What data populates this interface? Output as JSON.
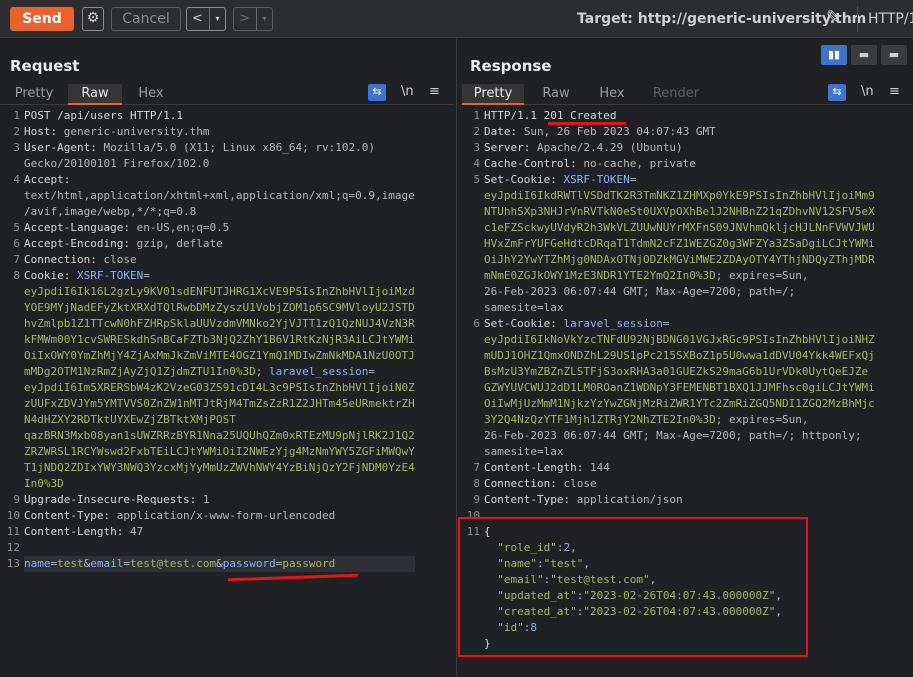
{
  "toolbar": {
    "send": "Send",
    "gear": "⚙",
    "cancel": "Cancel",
    "back": "<",
    "fwd": ">",
    "dd": "▾",
    "target": "Target: http://generic-university.thm",
    "pencil": "✎",
    "http": "HTTP/1"
  },
  "request": {
    "title": "Request",
    "tabs": [
      "Pretty",
      "Raw",
      "Hex"
    ],
    "wrap": "⇆",
    "nl": "\\n",
    "menu": "≡"
  },
  "response": {
    "title": "Response",
    "tabs": [
      "Pretty",
      "Raw",
      "Hex",
      "Render"
    ],
    "wrap": "⇆",
    "nl": "\\n",
    "menu": "≡"
  },
  "layout_buttons": [
    "▮▮",
    "▬",
    "▬"
  ],
  "request_lines": [
    {
      "n": "1",
      "segs": [
        [
          "k",
          "POST /api/users HTTP/1.1"
        ]
      ]
    },
    {
      "n": "2",
      "segs": [
        [
          "k",
          "Host: "
        ],
        [
          "v",
          "generic-university.thm"
        ]
      ]
    },
    {
      "n": "3",
      "segs": [
        [
          "k",
          "User-Agent: "
        ],
        [
          "v",
          "Mozilla/5.0 (X11; Linux x86_64; rv:102.0)"
        ]
      ]
    },
    {
      "n": "",
      "segs": [
        [
          "v",
          "Gecko/20100101 Firefox/102.0"
        ]
      ]
    },
    {
      "n": "4",
      "segs": [
        [
          "k",
          "Accept:"
        ]
      ]
    },
    {
      "n": "",
      "segs": [
        [
          "v",
          "text/html,application/xhtml+xml,application/xml;q=0.9,image"
        ]
      ]
    },
    {
      "n": "",
      "segs": [
        [
          "v",
          "/avif,image/webp,*/*;q=0.8"
        ]
      ]
    },
    {
      "n": "5",
      "segs": [
        [
          "k",
          "Accept-Language: "
        ],
        [
          "v",
          "en-US,en;q=0.5"
        ]
      ]
    },
    {
      "n": "6",
      "segs": [
        [
          "k",
          "Accept-Encoding: "
        ],
        [
          "v",
          "gzip, deflate"
        ]
      ]
    },
    {
      "n": "7",
      "segs": [
        [
          "k",
          "Connection: "
        ],
        [
          "v",
          "close"
        ]
      ]
    },
    {
      "n": "8",
      "segs": [
        [
          "k",
          "Cookie: "
        ],
        [
          "blue",
          "XSRF-TOKEN"
        ],
        [
          "v",
          "="
        ]
      ]
    },
    {
      "n": "",
      "segs": [
        [
          "g",
          "eyJpdiI6Ik16L2gzLy9KV01sdENFUTJHRG1XcVE9PSIsInZhbHVlIjoiMzd"
        ]
      ]
    },
    {
      "n": "",
      "segs": [
        [
          "g",
          "YOE9MYjNadEFyZktXRXdTQlRwbDMzZyszU1VobjZOM1p6SC9MVloyU2JSTD"
        ]
      ]
    },
    {
      "n": "",
      "segs": [
        [
          "g",
          "hvZmlpb1Z1TTcwN0hFZHRpSklaUUVzdmVMNko2YjVJTT1zQ1QzNUJ4VzN3R"
        ]
      ]
    },
    {
      "n": "",
      "segs": [
        [
          "g",
          "kFMWm00Y1cvSWRESkdhSnBCaFZTb3NjQ2ZhY1B6V1RtKzNjR3AiLCJtYWMi"
        ]
      ]
    },
    {
      "n": "",
      "segs": [
        [
          "g",
          "OiIxOWY0YmZhMjY4ZjAxMmJkZmViMTE4OGZ1YmQ1MDIwZmNkMDA1NzU0OTJ"
        ]
      ]
    },
    {
      "n": "",
      "segs": [
        [
          "g",
          "mMDg2OTM1NzRmZjAyZjQ1ZjdmZTU1In0%3D"
        ],
        [
          "v",
          "; "
        ],
        [
          "blue",
          "laravel_session"
        ],
        [
          "v",
          "="
        ]
      ]
    },
    {
      "n": "",
      "segs": [
        [
          "g",
          "eyJpdiI6Im5XRERSbW4zK2VzeG03ZS91cDI4L3c9PSIsInZhbHVlIjoiN0Z"
        ]
      ]
    },
    {
      "n": "",
      "segs": [
        [
          "g",
          "zUUFxZDVJYm5YMTVVS0ZnZW1nMTJtRjM4TmZsZzR1Z2JHTm45eURmektrZH"
        ]
      ]
    },
    {
      "n": "",
      "segs": [
        [
          "g",
          "N4dHZXY2RDTktUYXEwZjZBTktXMjPOST"
        ]
      ]
    },
    {
      "n": "",
      "segs": [
        [
          "g",
          "qazBRN3Mxb08yan1sUWZRRzBYR1Nna25UQUhQZm0xRTEzMU9pNjlRK2J1Q2"
        ]
      ]
    },
    {
      "n": "",
      "segs": [
        [
          "g",
          "ZRZWRSL1RCYWswd2FxbTEiLCJtYWMiOiI2NWEzYjg4MzNmYWY5ZGFiMWQwY"
        ]
      ]
    },
    {
      "n": "",
      "segs": [
        [
          "g",
          "T1jNDQ2ZDIxYWY3NWQ3YzcxMjYyMmUzZWVhNWY4YzBiNjQzY2FjNDM0YzE4"
        ]
      ]
    },
    {
      "n": "",
      "segs": [
        [
          "g",
          "In0%3D"
        ]
      ]
    },
    {
      "n": "9",
      "segs": [
        [
          "k",
          "Upgrade-Insecure-Requests: "
        ],
        [
          "v",
          "1"
        ]
      ]
    },
    {
      "n": "10",
      "segs": [
        [
          "k",
          "Content-Type: "
        ],
        [
          "v",
          "application/x-www-form-urlencoded"
        ]
      ]
    },
    {
      "n": "11",
      "segs": [
        [
          "k",
          "Content-Length: "
        ],
        [
          "v",
          "47"
        ]
      ]
    },
    {
      "n": "12",
      "segs": [
        [
          "k",
          ""
        ]
      ]
    },
    {
      "n": "13",
      "segs": [
        [
          "blue",
          "name"
        ],
        [
          "v",
          "="
        ],
        [
          "g",
          "test"
        ],
        [
          "v",
          "&"
        ],
        [
          "blue",
          "email"
        ],
        [
          "v",
          "="
        ],
        [
          "g",
          "test@test.com"
        ],
        [
          "v",
          "&"
        ],
        [
          "blue",
          "password"
        ],
        [
          "v",
          "="
        ],
        [
          "g",
          "password"
        ]
      ]
    }
  ],
  "response_lines": [
    {
      "n": "1",
      "segs": [
        [
          "k",
          "HTTP/1.1 201 Created"
        ]
      ]
    },
    {
      "n": "2",
      "segs": [
        [
          "k",
          "Date: "
        ],
        [
          "v",
          "Sun, 26 Feb 2023 04:07:43 GMT"
        ]
      ]
    },
    {
      "n": "3",
      "segs": [
        [
          "k",
          "Server: "
        ],
        [
          "v",
          "Apache/2.4.29 (Ubuntu)"
        ]
      ]
    },
    {
      "n": "4",
      "segs": [
        [
          "k",
          "Cache-Control: "
        ],
        [
          "v",
          "no-cache, private"
        ]
      ]
    },
    {
      "n": "5",
      "segs": [
        [
          "k",
          "Set-Cookie: "
        ],
        [
          "blue",
          "XSRF-TOKEN"
        ],
        [
          "v",
          "="
        ]
      ]
    },
    {
      "n": "",
      "segs": [
        [
          "g",
          "eyJpdiI6IkdRWTlVSDdTK2R3TmNKZ1ZHMXp0YkE9PSIsInZhbHVlIjoiMm9"
        ]
      ]
    },
    {
      "n": "",
      "segs": [
        [
          "g",
          "NTUhhSXp3NHJrVnRVTkN0eSt0UXVpOXhBe1J2NHBnZ21qZDhvNV12SFV5eX"
        ]
      ]
    },
    {
      "n": "",
      "segs": [
        [
          "g",
          "c1eFZSckwyUVdyR2h3WkVLZUUwNUYrMXFnS09JNVhmQkljcHJLNnFVWVJWU"
        ]
      ]
    },
    {
      "n": "",
      "segs": [
        [
          "g",
          "HVxZmFrYUFGeHdtcDRqaT1TdmN2cFZ1WEZGZ0g3WFZYa3ZSaDgiLCJtYWMi"
        ]
      ]
    },
    {
      "n": "",
      "segs": [
        [
          "g",
          "OiJhY2YwYTZhMjg0NDAxOTNjODZkMGViMWE2ZDAyOTY4YThjNDQyZThjMDR"
        ]
      ]
    },
    {
      "n": "",
      "segs": [
        [
          "g",
          "mNmE0ZGJkOWY1MzE3NDR1YTE2YmQ2In0%3D"
        ],
        [
          "v",
          "; expires=Sun,"
        ]
      ]
    },
    {
      "n": "",
      "segs": [
        [
          "v",
          "26-Feb-2023 06:07:44 GMT; Max-Age=7200; path=/;"
        ]
      ]
    },
    {
      "n": "",
      "segs": [
        [
          "v",
          "samesite=lax"
        ]
      ]
    },
    {
      "n": "6",
      "segs": [
        [
          "k",
          "Set-Cookie: "
        ],
        [
          "blue",
          "laravel_session"
        ],
        [
          "v",
          "="
        ]
      ]
    },
    {
      "n": "",
      "segs": [
        [
          "g",
          "eyJpdiI6IkNoVkYzcTNFdU92NjBDNG01VGJxRGc9PSIsInZhbHVlIjoiNHZ"
        ]
      ]
    },
    {
      "n": "",
      "segs": [
        [
          "g",
          "mUDJ1OHZ1QmxONDZhL29US1pPc215SXBoZ1p5U0wwa1dDVU04Ykk4WEFxQj"
        ]
      ]
    },
    {
      "n": "",
      "segs": [
        [
          "g",
          "BsMzU3YmZBZnZLSTFjS3oxRHA3a01GUEZkS29maG6b1UrVDk0UytQeEJZe"
        ]
      ]
    },
    {
      "n": "",
      "segs": [
        [
          "g",
          "GZWYUVCWUJ2dD1LM0ROanZ1WDNpY3FEMENBT1BXQ1JJMFhsc0giLCJtYWMi"
        ]
      ]
    },
    {
      "n": "",
      "segs": [
        [
          "g",
          "OiIwMjUzMmM1NjkzYzYwZGNjMzRiZWR1YTc2ZmRiZGQ5NDI1ZGQ2MzBhMjc"
        ]
      ]
    },
    {
      "n": "",
      "segs": [
        [
          "g",
          "3Y2Q4NzQzYTF1Mjh1ZTRjY2NhZTE2In0%3D"
        ],
        [
          "v",
          "; expires=Sun,"
        ]
      ]
    },
    {
      "n": "",
      "segs": [
        [
          "v",
          "26-Feb-2023 06:07:44 GMT; Max-Age=7200; path=/; httponly;"
        ]
      ]
    },
    {
      "n": "",
      "segs": [
        [
          "v",
          "samesite=lax"
        ]
      ]
    },
    {
      "n": "7",
      "segs": [
        [
          "k",
          "Content-Length: "
        ],
        [
          "v",
          "144"
        ]
      ]
    },
    {
      "n": "8",
      "segs": [
        [
          "k",
          "Connection: "
        ],
        [
          "v",
          "close"
        ]
      ]
    },
    {
      "n": "9",
      "segs": [
        [
          "k",
          "Content-Type: "
        ],
        [
          "v",
          "application/json"
        ]
      ]
    },
    {
      "n": "10",
      "segs": [
        [
          "k",
          ""
        ]
      ]
    },
    {
      "n": "11",
      "segs": [
        [
          "k",
          "{"
        ]
      ]
    },
    {
      "n": "",
      "segs": [
        [
          "v",
          "  "
        ],
        [
          "g",
          "\"role_id\""
        ],
        [
          "v",
          ":"
        ],
        [
          "blue",
          "2"
        ],
        [
          "v",
          ","
        ]
      ]
    },
    {
      "n": "",
      "segs": [
        [
          "v",
          "  "
        ],
        [
          "g",
          "\"name\""
        ],
        [
          "v",
          ":"
        ],
        [
          "g",
          "\"test\""
        ],
        [
          "v",
          ","
        ]
      ]
    },
    {
      "n": "",
      "segs": [
        [
          "v",
          "  "
        ],
        [
          "g",
          "\"email\""
        ],
        [
          "v",
          ":"
        ],
        [
          "g",
          "\"test@test.com\""
        ],
        [
          "v",
          ","
        ]
      ]
    },
    {
      "n": "",
      "segs": [
        [
          "v",
          "  "
        ],
        [
          "g",
          "\"updated_at\""
        ],
        [
          "v",
          ":"
        ],
        [
          "g",
          "\"2023-02-26T04:07:43.000000Z\""
        ],
        [
          "v",
          ","
        ]
      ]
    },
    {
      "n": "",
      "segs": [
        [
          "v",
          "  "
        ],
        [
          "g",
          "\"created_at\""
        ],
        [
          "v",
          ":"
        ],
        [
          "g",
          "\"2023-02-26T04:07:43.000000Z\""
        ],
        [
          "v",
          ","
        ]
      ]
    },
    {
      "n": "",
      "segs": [
        [
          "v",
          "  "
        ],
        [
          "g",
          "\"id\""
        ],
        [
          "v",
          ":"
        ],
        [
          "blue",
          "8"
        ]
      ]
    },
    {
      "n": "",
      "segs": [
        [
          "k",
          "}"
        ]
      ]
    }
  ]
}
